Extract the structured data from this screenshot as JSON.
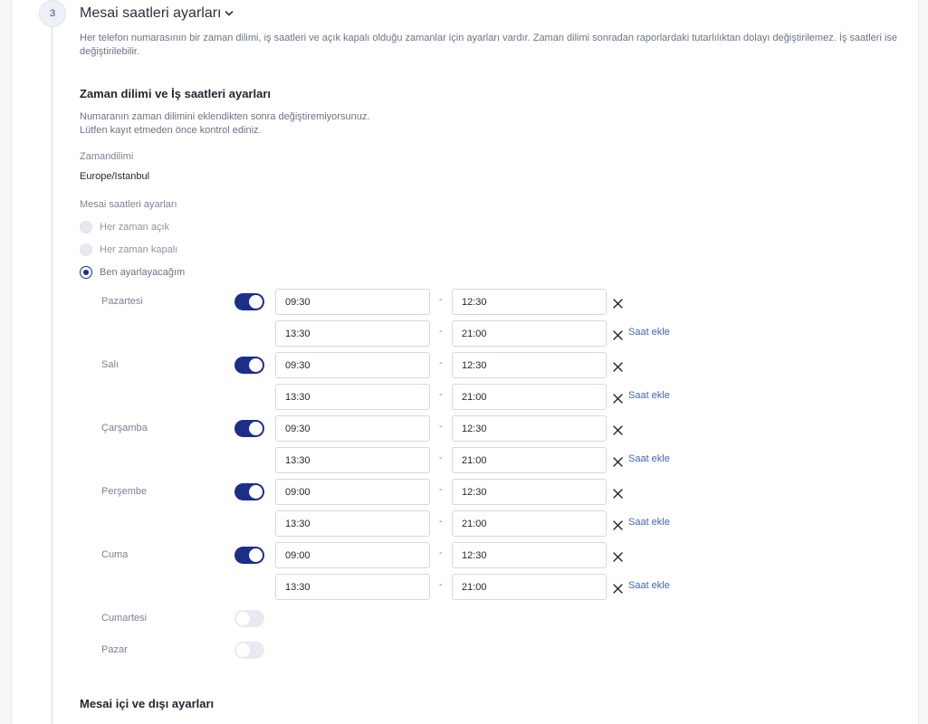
{
  "section": {
    "step_number": "3",
    "title": "Mesai saatleri ayarları",
    "description": "Her telefon numarasının bir zaman dilimi, iş saatleri ve açık kapalı olduğu zamanlar için ayarları vardır. Zaman dilimi sonradan raporlardaki tutarlılıktan dolayı değiştirilemez. İş saatleri ise değiştirilebilir."
  },
  "timezone_block": {
    "heading": "Zaman dilimi ve İş saatleri ayarları",
    "note_line1": "Numaranın zaman dilimini eklendikten sonra değiştiremiyorsunuz.",
    "note_line2": "Lütfen kayıt etmeden önce kontrol ediniz.",
    "timezone_label": "Zamandilimi",
    "timezone_value": "Europe/Istanbul",
    "hours_label": "Mesai saatleri ayarları"
  },
  "mode_options": [
    {
      "label": "Her zaman açık",
      "selected": false
    },
    {
      "label": "Her zaman kapalı",
      "selected": false
    },
    {
      "label": "Ben ayarlayacağım",
      "selected": true
    }
  ],
  "days": [
    {
      "name": "Pazartesi",
      "enabled": true,
      "slots": [
        {
          "start": "09:30",
          "end": "12:30"
        },
        {
          "start": "13:30",
          "end": "21:00"
        }
      ]
    },
    {
      "name": "Salı",
      "enabled": true,
      "slots": [
        {
          "start": "09:30",
          "end": "12:30"
        },
        {
          "start": "13:30",
          "end": "21:00"
        }
      ]
    },
    {
      "name": "Çarşamba",
      "enabled": true,
      "slots": [
        {
          "start": "09:30",
          "end": "12:30"
        },
        {
          "start": "13:30",
          "end": "21:00"
        }
      ]
    },
    {
      "name": "Perşembe",
      "enabled": true,
      "slots": [
        {
          "start": "09:00",
          "end": "12:30"
        },
        {
          "start": "13:30",
          "end": "21:00"
        }
      ]
    },
    {
      "name": "Cuma",
      "enabled": true,
      "slots": [
        {
          "start": "09:00",
          "end": "12:30"
        },
        {
          "start": "13:30",
          "end": "21:00"
        }
      ]
    },
    {
      "name": "Cumartesi",
      "enabled": false,
      "slots": []
    },
    {
      "name": "Pazar",
      "enabled": false,
      "slots": []
    }
  ],
  "labels": {
    "range_separator": "-",
    "add_hours": "Saat ekle"
  },
  "next_section": {
    "heading": "Mesai içi ve dışı ayarları"
  },
  "colors": {
    "accent": "#1b2e8a",
    "link": "#3f66b8",
    "muted_text": "#7a8294"
  }
}
